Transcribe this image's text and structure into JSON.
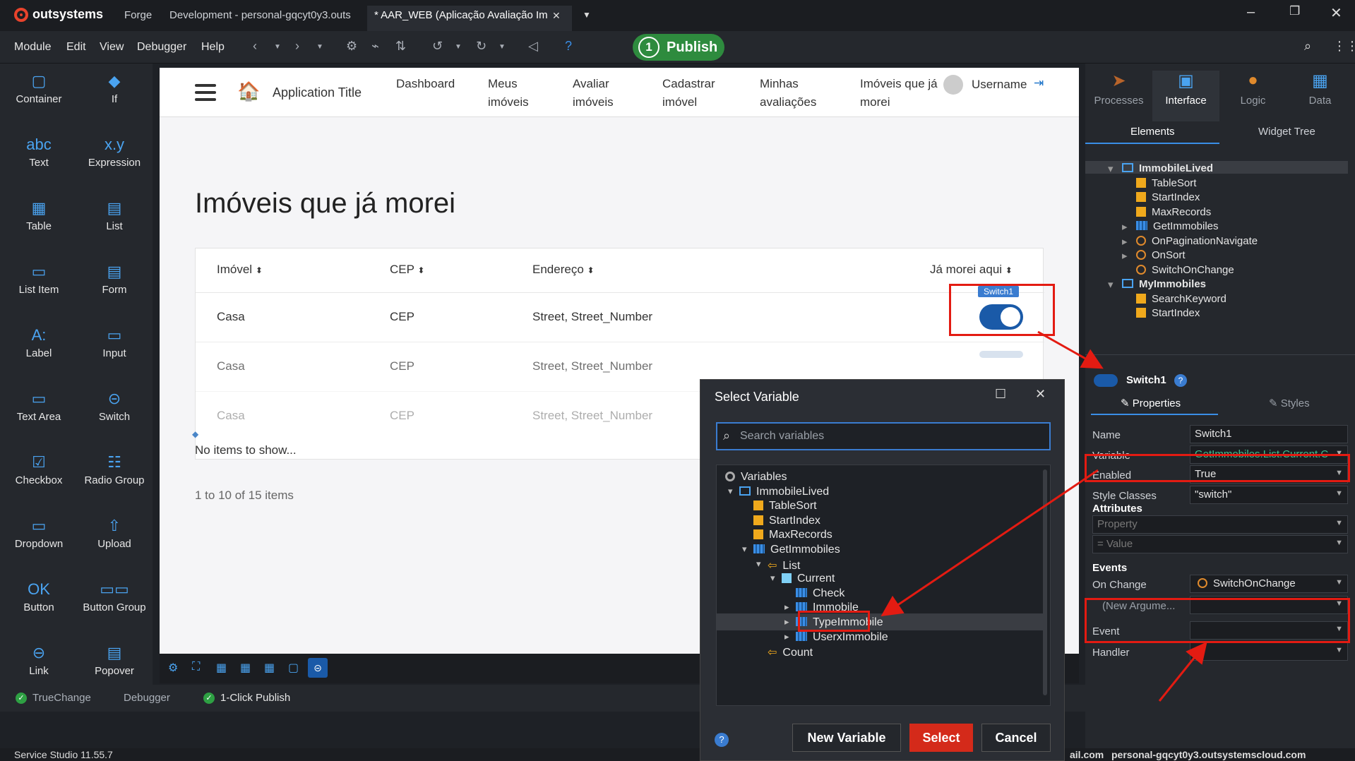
{
  "titlebar": {
    "logo": "outsystems",
    "tabs": [
      "Forge",
      "Development - personal-gqcyt0y3.outs",
      "* AAR_WEB (Aplicação Avaliação Im"
    ]
  },
  "menubar": {
    "items": [
      "Module",
      "Edit",
      "View",
      "Debugger",
      "Help"
    ],
    "publish_label": "Publish",
    "publish_count": "1"
  },
  "toolbox": {
    "items": [
      "Container",
      "If",
      "Text",
      "Expression",
      "Table",
      "List",
      "List Item",
      "Form",
      "Label",
      "Input",
      "Text Area",
      "Switch",
      "Checkbox",
      "Radio Group",
      "Dropdown",
      "Upload",
      "Button",
      "Button Group",
      "Link",
      "Popover"
    ],
    "icons": [
      "▢",
      "◆",
      "abc",
      "x.y",
      "▦",
      "▤",
      "▭",
      "▤",
      "A:",
      "▭",
      "▭",
      "⊝",
      "☑",
      "☷",
      "▭",
      "⇧",
      "OK",
      "▭▭",
      "⊖",
      "▤"
    ]
  },
  "canvas": {
    "app_title": "Application Title",
    "nav": [
      "Dashboard",
      "Meus imóveis",
      "Avaliar imóveis",
      "Cadastrar imóvel",
      "Minhas avaliações",
      "Imóveis que já morei"
    ],
    "username": "Username",
    "page_title": "Imóveis que já morei",
    "columns": [
      "Imóvel",
      "CEP",
      "Endereço",
      "Já morei aqui"
    ],
    "rows": [
      [
        "Casa",
        "CEP",
        "Street, Street_Number"
      ],
      [
        "Casa",
        "CEP",
        "Street, Street_Number"
      ],
      [
        "Casa",
        "CEP",
        "Street, Street_Number"
      ]
    ],
    "switch_badge": "Switch1",
    "no_items": "No items to show...",
    "pagination": "1 to 10 of 15 items"
  },
  "bottom": {
    "tabs": [
      "TrueChange",
      "Debugger",
      "1-Click Publish"
    ],
    "status_left": "Service Studio 11.55.7",
    "status_right_prefix": "ail.com",
    "status_right": "personal-gqcyt0y3.outsystemscloud.com"
  },
  "rightpanel": {
    "tabs": [
      "Processes",
      "Interface",
      "Logic",
      "Data"
    ],
    "subtabs": [
      "Elements",
      "Widget Tree"
    ],
    "tree": [
      {
        "label": "ImmobileLived",
        "type": "box",
        "level": 0
      },
      {
        "label": "TableSort",
        "type": "sq",
        "level": 1
      },
      {
        "label": "StartIndex",
        "type": "sq",
        "level": 1
      },
      {
        "label": "MaxRecords",
        "type": "sq",
        "level": 1
      },
      {
        "label": "GetImmobiles",
        "type": "grid",
        "level": 1
      },
      {
        "label": "OnPaginationNavigate",
        "type": "circ",
        "level": 1
      },
      {
        "label": "OnSort",
        "type": "circ",
        "level": 1
      },
      {
        "label": "SwitchOnChange",
        "type": "circ",
        "level": 1
      },
      {
        "label": "MyImmobiles",
        "type": "box",
        "level": 0
      },
      {
        "label": "SearchKeyword",
        "type": "sq",
        "level": 1
      },
      {
        "label": "StartIndex",
        "type": "sq",
        "level": 1
      }
    ],
    "widget_name": "Switch1",
    "prop_tabs": [
      "Properties",
      "Styles"
    ],
    "properties": [
      {
        "label": "Name",
        "value": "Switch1"
      },
      {
        "label": "Variable",
        "value": "GetImmobiles.List.Current.C"
      },
      {
        "label": "Enabled",
        "value": "True"
      },
      {
        "label": "Style Classes",
        "value": "\"switch\""
      }
    ],
    "attributes_heading": "Attributes",
    "attr_property_placeholder": "Property",
    "attr_value_placeholder": "Value",
    "events_heading": "Events",
    "on_change_label": "On Change",
    "on_change_value": "SwitchOnChange",
    "new_argument": "(New Argume...",
    "event_label": "Event",
    "handler_label": "Handler"
  },
  "dialog": {
    "title": "Select Variable",
    "search_placeholder": "Search variables",
    "tree": [
      {
        "label": "Variables",
        "indent": 0
      },
      {
        "label": "ImmobileLived",
        "indent": 1
      },
      {
        "label": "TableSort",
        "indent": 2
      },
      {
        "label": "StartIndex",
        "indent": 2
      },
      {
        "label": "MaxRecords",
        "indent": 2
      },
      {
        "label": "GetImmobiles",
        "indent": 2
      },
      {
        "label": "List",
        "indent": 3
      },
      {
        "label": "Current",
        "indent": 4
      },
      {
        "label": "Check",
        "indent": 5
      },
      {
        "label": "Immobile",
        "indent": 5
      },
      {
        "label": "TypeImmobile",
        "indent": 5
      },
      {
        "label": "UserxImmobile",
        "indent": 5
      },
      {
        "label": "Count",
        "indent": 3
      }
    ],
    "buttons": [
      "New Variable",
      "Select",
      "Cancel"
    ]
  },
  "colors": {
    "highlight": "#e31b12",
    "accent": "#1a5aa8",
    "publish": "#2e8b3e"
  }
}
